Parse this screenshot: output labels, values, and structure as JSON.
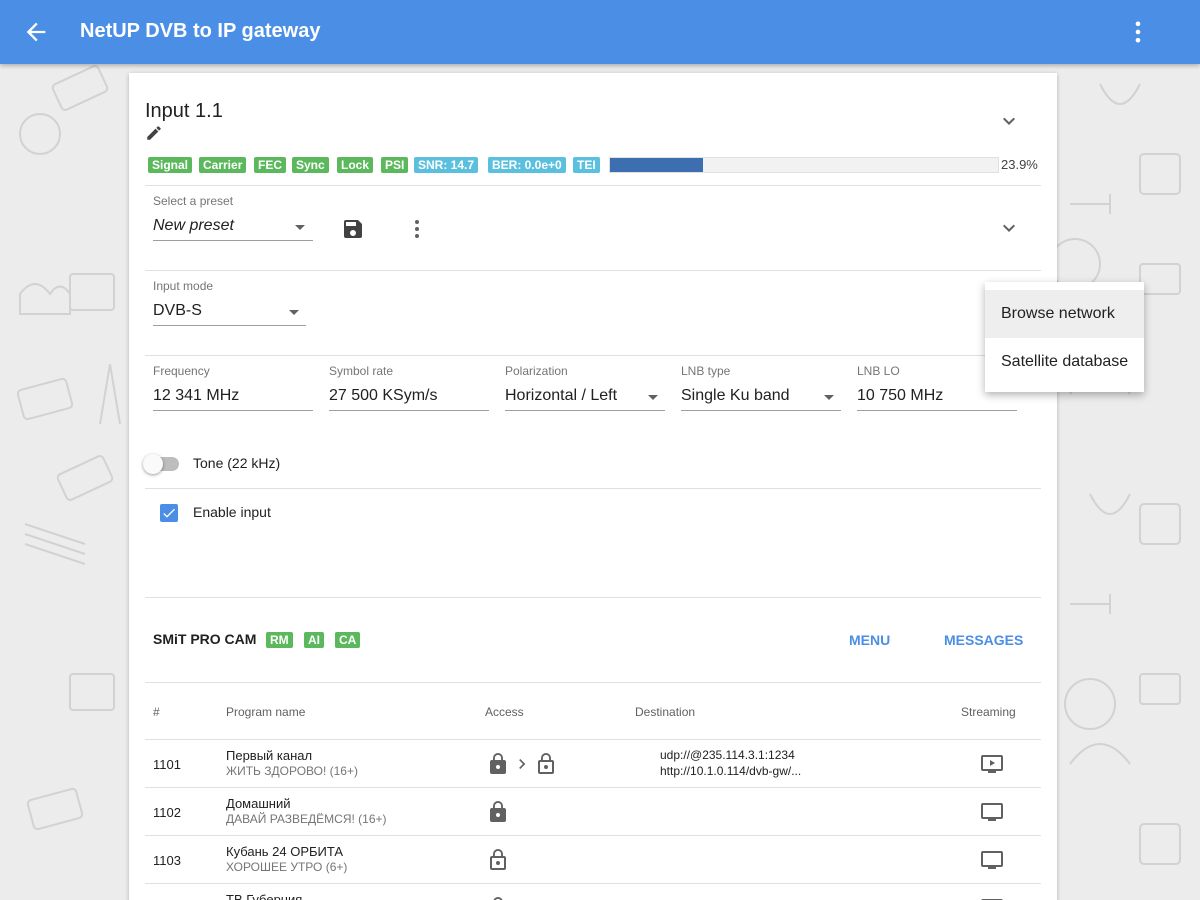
{
  "appbar": {
    "title": "NetUP DVB to IP gateway",
    "back_icon": "arrow-back-icon",
    "more_icon": "more-vert-icon",
    "color": "#4a8ee6"
  },
  "input": {
    "title": "Input 1.1",
    "edit_icon": "pencil-icon",
    "status_badges": [
      "Signal",
      "Carrier",
      "FEC",
      "Sync",
      "Lock",
      "PSI"
    ],
    "snr_badge": "SNR: 14.7",
    "ber_badge": "BER: 0.0e+0",
    "tei_badge": "TEI",
    "level_fraction": 0.239,
    "level_text": "23.9%"
  },
  "preset": {
    "label": "Select a preset",
    "value": "New preset",
    "save_icon": "save-icon",
    "more_icon": "more-vert-icon"
  },
  "input_mode": {
    "label": "Input mode",
    "value": "DVB-S"
  },
  "fields": {
    "frequency": {
      "label": "Frequency",
      "value": "12 341 MHz"
    },
    "symbol_rate": {
      "label": "Symbol rate",
      "value": "27 500 KSym/s"
    },
    "polarization": {
      "label": "Polarization",
      "value": "Horizontal / Left"
    },
    "lnb_type": {
      "label": "LNB type",
      "value": "Single Ku band"
    },
    "lnb_lo": {
      "label": "LNB LO",
      "value": "10 750 MHz"
    }
  },
  "tone": {
    "label": "Tone (22 kHz)",
    "on": false
  },
  "enable_input": {
    "label": "Enable input",
    "checked": true
  },
  "menu": {
    "items": [
      "Browse network",
      "Satellite database"
    ]
  },
  "cam": {
    "name": "SMiT PRO CAM",
    "badges": [
      "RM",
      "AI",
      "CA"
    ],
    "menu_label": "MENU",
    "messages_label": "MESSAGES"
  },
  "table": {
    "headers": [
      "#",
      "Program name",
      "Access",
      "Destination",
      "Streaming"
    ],
    "rows": [
      {
        "num": "1101",
        "name": "Первый канал",
        "event": "ЖИТЬ ЗДОРОВО! (16+)",
        "access": "lock-to-unlock",
        "dest1": "udp://@235.114.3.1:1234",
        "dest2": "http://10.1.0.114/dvb-gw/...",
        "streaming": "play-monitor-icon"
      },
      {
        "num": "1102",
        "name": "Домашний",
        "event": "ДАВАЙ РАЗВЕДЁМСЯ! (16+)",
        "access": "lock",
        "dest1": "",
        "dest2": "",
        "streaming": "monitor-icon"
      },
      {
        "num": "1103",
        "name": "Кубань 24 ОРБИТА",
        "event": "ХОРОШЕЕ УТРО (6+)",
        "access": "unlock",
        "dest1": "",
        "dest2": "",
        "streaming": "monitor-icon"
      },
      {
        "num": "",
        "name": "ТВ Губерния",
        "event": "",
        "access": "lock",
        "dest1": "",
        "dest2": "",
        "streaming": "monitor-icon"
      }
    ]
  },
  "colors": {
    "accent": "#4a8ee6",
    "badge_green": "#5cb85c",
    "badge_blue": "#5bc0de",
    "bar_fill": "#3d6fb0"
  }
}
